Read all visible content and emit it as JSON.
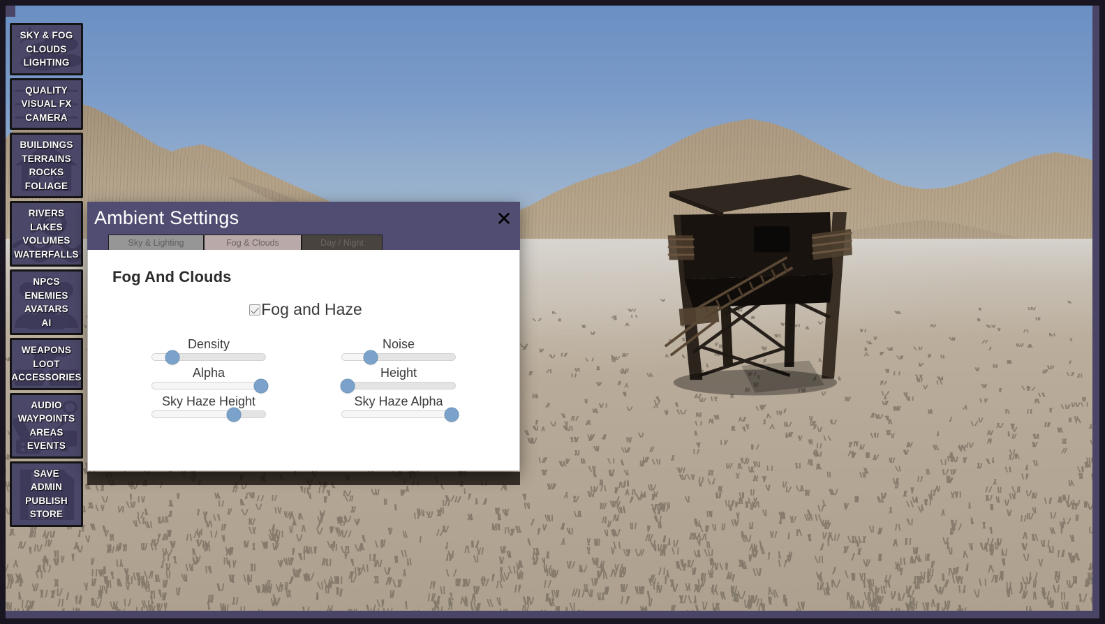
{
  "app": {
    "title": "Ambient Settings"
  },
  "sidebar": {
    "items": [
      {
        "name": "sky-fog-clouds-lighting",
        "icon": "clouds-sun-icon",
        "lines": [
          "SKY & FOG",
          "CLOUDS",
          "LIGHTING"
        ]
      },
      {
        "name": "quality-visual-fx-camera",
        "icon": "sliders-camera-icon",
        "lines": [
          "QUALITY",
          "VISUAL FX",
          "CAMERA"
        ]
      },
      {
        "name": "buildings-terrains-rocks-foliage",
        "icon": "house-icon",
        "lines": [
          "BUILDINGS",
          "TERRAINS",
          "ROCKS",
          "FOLIAGE"
        ]
      },
      {
        "name": "rivers-lakes-volumes-waterfalls",
        "icon": "water-waves-icon",
        "lines": [
          "RIVERS",
          "LAKES",
          "VOLUMES",
          "WATERFALLS"
        ]
      },
      {
        "name": "npcs-enemies-avatars-ai",
        "icon": "people-group-icon",
        "lines": [
          "NPCS",
          "ENEMIES",
          "AVATARS",
          "AI"
        ]
      },
      {
        "name": "weapons-loot-accessories",
        "icon": "weapons-crate-icon",
        "lines": [
          "WEAPONS",
          "LOOT",
          "ACCESSORIES"
        ]
      },
      {
        "name": "audio-waypoints-areas-events",
        "icon": "microphone-monitor-icon",
        "lines": [
          "AUDIO",
          "WAYPOINTS",
          "AREAS",
          "EVENTS"
        ]
      },
      {
        "name": "save-admin-publish-store",
        "icon": "save-disk-icon",
        "lines": [
          "SAVE",
          "ADMIN",
          "PUBLISH",
          "STORE"
        ]
      }
    ]
  },
  "dialog": {
    "title": "Ambient Settings",
    "close_label": "✕",
    "tabs": [
      {
        "label": "Sky & Lighting",
        "selected": false
      },
      {
        "label": "Fog & Clouds",
        "selected": true
      },
      {
        "label": "Day / Night",
        "selected": false
      }
    ],
    "section_title": "Fog And Clouds",
    "checkbox": {
      "label": "Fog and Haze",
      "checked": true
    },
    "sliders_left": [
      {
        "label": "Density",
        "value": 18
      },
      {
        "label": "Alpha",
        "value": 96
      },
      {
        "label": "Sky Haze Height",
        "value": 72
      }
    ],
    "sliders_right": [
      {
        "label": "Noise",
        "value": 25
      },
      {
        "label": "Height",
        "value": 5
      },
      {
        "label": "Sky Haze Alpha",
        "value": 97
      }
    ]
  },
  "colors": {
    "dialog_header": "#514d72",
    "sidebar_button": "#4b4768",
    "slider_thumb": "#7ba2ca",
    "tab_selected": "#b9aaa9",
    "tab_normal": "#969696",
    "tab_dark": "#494340",
    "frame": "#191621",
    "frame_inner": "#4a4566"
  },
  "scene": {
    "description": "desert-terrain-with-watchtower",
    "sky_top": "#6a8fc2",
    "sky_bottom": "#b9c6d3",
    "ground": "#b8aa98",
    "tower": "wooden-watchtower"
  }
}
